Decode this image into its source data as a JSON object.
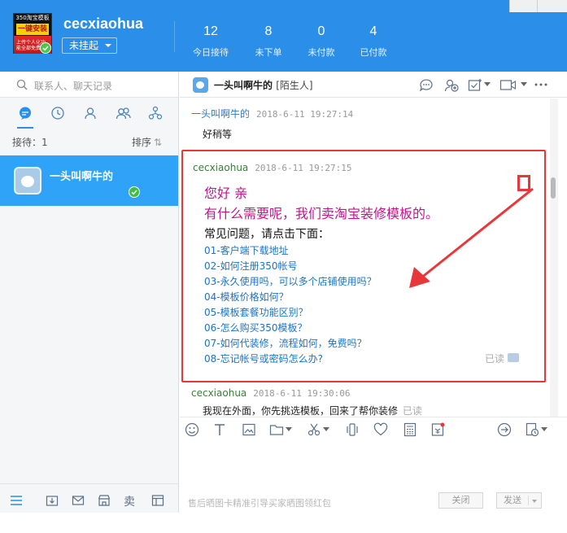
{
  "header": {
    "avatar": {
      "line1": "350淘宝模板",
      "line2": "一键安装",
      "line3": "上传个人化功能全部免费"
    },
    "username": "cecxiaohua",
    "status": "未挂起",
    "stats": [
      {
        "value": "12",
        "label": "今日接待"
      },
      {
        "value": "8",
        "label": "未下单"
      },
      {
        "value": "0",
        "label": "未付款"
      },
      {
        "value": "4",
        "label": "已付款"
      }
    ]
  },
  "sidebar": {
    "search_placeholder": "联系人、聊天记录",
    "tabs": [
      "chat-icon",
      "clock-icon",
      "person-icon",
      "group-icon",
      "org-icon"
    ],
    "queue_label": "接待：1",
    "sort_label": "排序",
    "sort_icon": "⇅",
    "contact": {
      "name": "一头叫啊牛的",
      "online": true
    },
    "bottom_icons": [
      "menu-icon",
      "download-icon",
      "mail-icon",
      "shop-icon",
      "sell-icon",
      "window-icon"
    ],
    "sell_text": "卖"
  },
  "chat": {
    "title": "一头叫啊牛的",
    "title_tag": "[陌生人]",
    "messages": [
      {
        "sender": "一头叫啊牛的",
        "time": "2018-6-11 19:27:14",
        "text": "好稍等"
      },
      {
        "sender": "cecxiaohua",
        "time": "2018-6-11 19:27:15",
        "greeting": "您好 亲",
        "intro": "有什么需要呢，我们卖淘宝装修模板的。",
        "faq_title": "常见问题，请点击下面：",
        "faq": [
          "01-客户端下载地址",
          "02-如何注册350帐号",
          "03-永久使用吗，可以多个店铺使用吗？",
          "04-模板价格如何？",
          "05-模板套餐功能区别？",
          "06-怎么购买350模板？",
          "07-如何代装修，流程如何，免费吗？",
          "08-忘记帐号或密码怎么办?"
        ],
        "read_status": "已读"
      },
      {
        "sender": "cecxiaohua",
        "time": "2018-6-11 19:30:06",
        "text": "我现在外面，你先挑选模板，回来了帮你装修",
        "read_status": "已读"
      }
    ]
  },
  "footer": {
    "tip": "售后晒图卡精准引导买家晒图领红包",
    "close_label": "关闭",
    "send_label": "发送"
  },
  "colors": {
    "header_bg": "#2b8ee8",
    "selected_contact": "#2ea3f7",
    "annotation": "#e8373a",
    "pink_text": "#c0178a",
    "link": "#1c73c8"
  }
}
